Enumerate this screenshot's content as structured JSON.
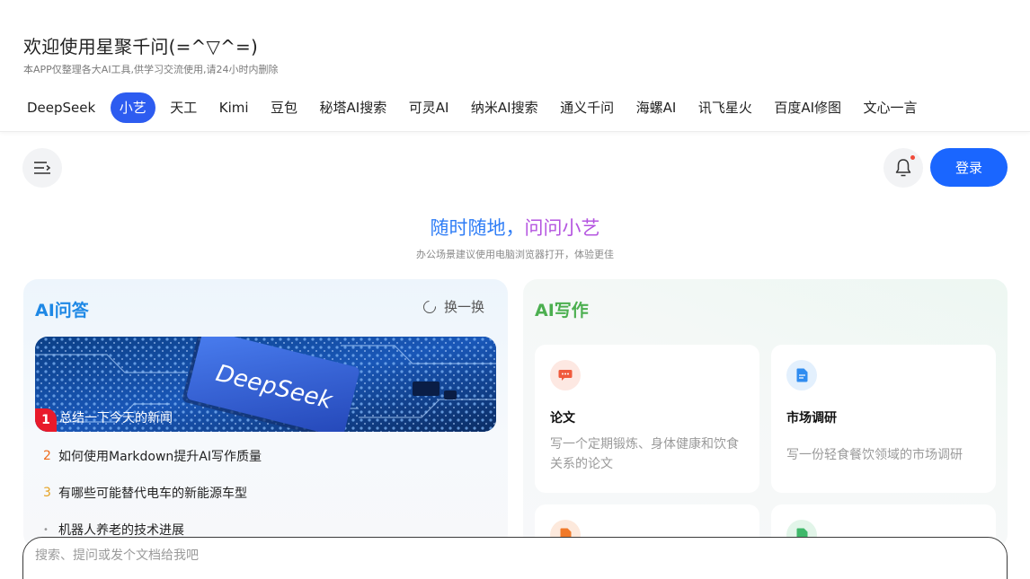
{
  "header": {
    "title": "欢迎使用星聚千问(=^▽^=)",
    "subtitle": "本APP仅整理各大AI工具,供学习交流使用,请24小时内删除",
    "tabs": [
      {
        "label": "DeepSeek",
        "active": false
      },
      {
        "label": "小艺",
        "active": true
      },
      {
        "label": "天工",
        "active": false
      },
      {
        "label": "Kimi",
        "active": false
      },
      {
        "label": "豆包",
        "active": false
      },
      {
        "label": "秘塔AI搜索",
        "active": false
      },
      {
        "label": "可灵AI",
        "active": false
      },
      {
        "label": "纳米AI搜索",
        "active": false
      },
      {
        "label": "通义千问",
        "active": false
      },
      {
        "label": "海螺AI",
        "active": false
      },
      {
        "label": "讯飞星火",
        "active": false
      },
      {
        "label": "百度AI修图",
        "active": false
      },
      {
        "label": "文心一言",
        "active": false
      }
    ]
  },
  "toolbar": {
    "menu_icon": "menu-collapse-icon",
    "bell_icon": "bell-icon",
    "login_label": "登录",
    "accent_color": "#1a66ff"
  },
  "hero": {
    "title_part1": "随时随地，",
    "title_part2": "问问小艺",
    "note": "办公场景建议使用电脑浏览器打开，体验更佳"
  },
  "qa": {
    "title": "AI问答",
    "refresh_label": "换一换",
    "banner_word": "DeepSeek",
    "items": [
      {
        "rank": "1",
        "text": "总结一下今天的新闻"
      },
      {
        "rank": "2",
        "text": "如何使用Markdown提升AI写作质量"
      },
      {
        "rank": "3",
        "text": "有哪些可能替代电车的新能源车型"
      },
      {
        "rank": "•",
        "text": "机器人养老的技术进展"
      }
    ]
  },
  "writing": {
    "title": "AI写作",
    "cards": [
      {
        "name": "论文",
        "desc": "写一个定期锻炼、身体健康和饮食关系的论文",
        "icon": "chat-bubble-icon",
        "color": "#f05a3c"
      },
      {
        "name": "市场调研",
        "desc": "写一份轻食餐饮领域的市场调研",
        "icon": "document-icon",
        "color": "#2f8cf0"
      },
      {
        "name": "",
        "desc": "",
        "icon": "edit-doc-icon",
        "color": "#f07a2a"
      },
      {
        "name": "",
        "desc": "",
        "icon": "sheet-icon",
        "color": "#3fb86a"
      }
    ]
  },
  "search": {
    "placeholder": "搜索、提问或发个文档给我吧"
  }
}
